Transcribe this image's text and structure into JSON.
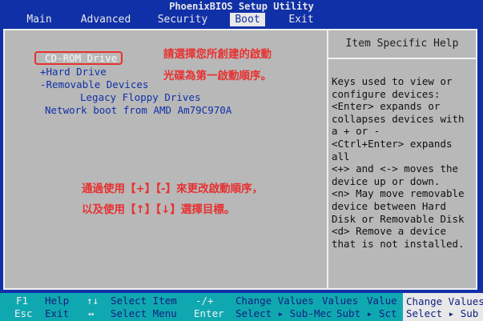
{
  "window": {
    "title": "PhoenixBIOS Setup Utility"
  },
  "menu": [
    {
      "label": "Main"
    },
    {
      "label": "Advanced"
    },
    {
      "label": "Security"
    },
    {
      "label": "Boot"
    },
    {
      "label": "Exit"
    }
  ],
  "active_menu": "Boot",
  "boot_items": [
    {
      "label": "CD-ROM Drive"
    },
    {
      "label": "+Hard Drive"
    },
    {
      "label": "-Removable Devices"
    },
    {
      "label": "Legacy Floppy Drives"
    },
    {
      "label": "Network boot from AMD Am79C970A"
    }
  ],
  "annotations": {
    "top_line1": "請選擇您所創建的啟動",
    "top_line2": "光碟為第一啟動順序。",
    "bottom_line1": "通過使用【+】【-】來更改啟動順序，",
    "bottom_line2": "以及使用【↑】【↓】選擇目標。"
  },
  "help": {
    "title": "Item Specific Help",
    "body": "Keys used to view or\nconfigure devices:\n<Enter> expands or\ncollapses devices with\na + or -\n<Ctrl+Enter> expands\nall\n<+> and <-> moves the\ndevice up or down.\n<n> May move removable\ndevice between Hard\nDisk or Removable Disk\n<d> Remove a device\nthat is not installed."
  },
  "footer": {
    "row1": {
      "k1": "F1",
      "d1": "Help",
      "k2": "↑↓",
      "d2": "Select Item",
      "k3": "-/+",
      "d3": "Change Values",
      "d4": "Values",
      "d5": "Value",
      "box": "Change Values"
    },
    "row2": {
      "k1": "Esc",
      "d1": "Exit",
      "k2": "↔",
      "d2": "Select Menu",
      "k3": "Enter",
      "d3": "Select ▸ Sub-Mec",
      "d4": "Subt ▸",
      "d5": "Sct",
      "box": "Select ▸ Sub"
    }
  },
  "colors": {
    "background": "#1030a8",
    "panel": "#b8b8b8",
    "footer": "#10a8b0",
    "annotation": "#e83030"
  }
}
